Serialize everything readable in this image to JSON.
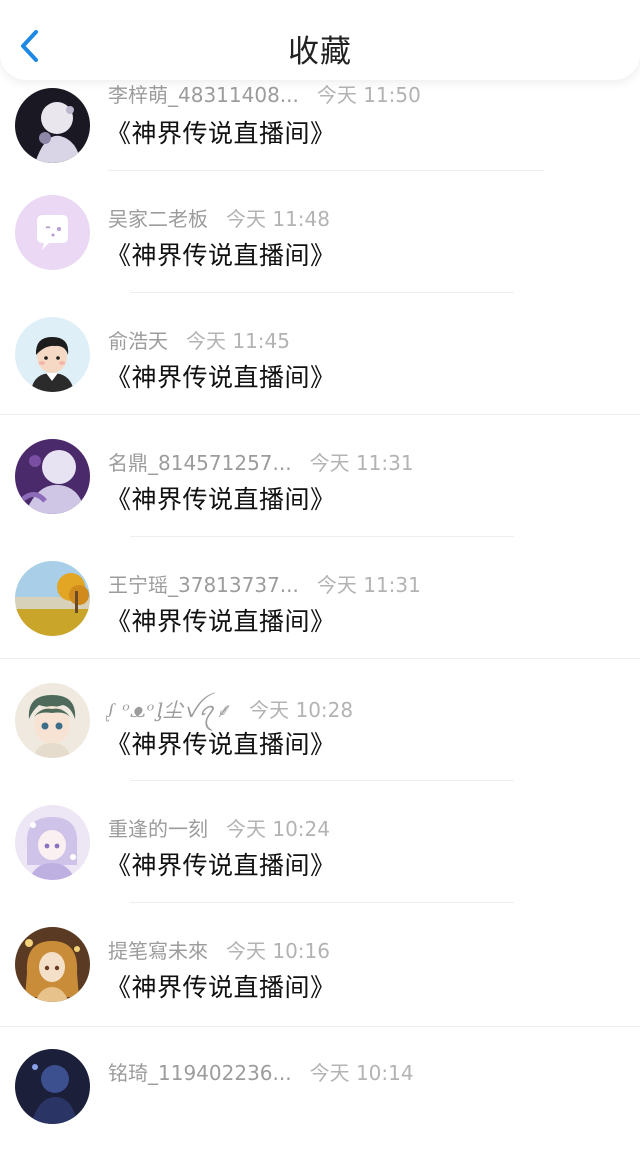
{
  "header": {
    "title": "收藏",
    "back_icon": "chevron-left-icon",
    "accent": "#1e88e5"
  },
  "items": [
    {
      "name": "李梓萌_48311408...",
      "time": "今天 11:50",
      "message": "《神界传说直播间》",
      "avatar": "anime-portrait-dark"
    },
    {
      "name": "吴家二老板",
      "time": "今天 11:48",
      "message": "《神界传说直播间》",
      "avatar": "chat-bubble-default"
    },
    {
      "name": "俞浩天",
      "time": "今天 11:45",
      "message": "《神界传说直播间》",
      "avatar": "cartoon-boy-default"
    },
    {
      "name": "名鼎_814571257...",
      "time": "今天 11:31",
      "message": "《神界传说直播间》",
      "avatar": "anime-purple"
    },
    {
      "name": "王宁瑶_37813737...",
      "time": "今天 11:31",
      "message": "《神界传说直播间》",
      "avatar": "landscape-autumn"
    },
    {
      "name": "ᶘ ᵒᴥᵒᶅ尘ꪜꪖ⸙",
      "time": "今天 10:28",
      "message": "《神界传说直播间》",
      "avatar": "anime-boy-green-hair"
    },
    {
      "name": "重逢的一刻",
      "time": "今天 10:24",
      "message": "《神界传说直播间》",
      "avatar": "anime-lavender-girl"
    },
    {
      "name": "提笔寫未來",
      "time": "今天 10:16",
      "message": "《神界传说直播间》",
      "avatar": "anime-golden-girl"
    },
    {
      "name": "铭琦_119402236...",
      "time": "今天 10:14",
      "message": "",
      "avatar": "anime-dark-blue"
    }
  ]
}
